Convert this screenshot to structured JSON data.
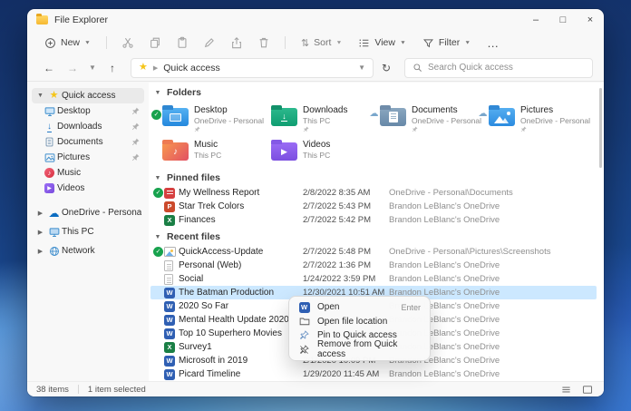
{
  "window": {
    "title": "File Explorer"
  },
  "icons": {
    "chevron_down": "▼",
    "chevron_right": "▶",
    "dropdown": "▼",
    "back": "←",
    "forward": "→",
    "up": "↑",
    "refresh": "↻",
    "more": "…",
    "minimize": "–",
    "maximize": "□",
    "close": "×",
    "star": "★",
    "cloud": "☁",
    "check": "✓",
    "arrow_down": "↓",
    "play": "▶",
    "note": "♪",
    "sort": "⇅",
    "word_letter": "W",
    "excel_letter": "X",
    "ppt_letter": "P"
  },
  "toolbar": {
    "new": "New",
    "sort": "Sort",
    "view": "View",
    "filter": "Filter"
  },
  "address": {
    "path": "Quick access",
    "search_placeholder": "Search Quick access"
  },
  "sidebar": {
    "items": [
      {
        "label": "Quick access"
      },
      {
        "label": "Desktop"
      },
      {
        "label": "Downloads"
      },
      {
        "label": "Documents"
      },
      {
        "label": "Pictures"
      },
      {
        "label": "Music"
      },
      {
        "label": "Videos"
      },
      {
        "label": "OneDrive - Personal"
      },
      {
        "label": "This PC"
      },
      {
        "label": "Network"
      }
    ]
  },
  "folders": {
    "title": "Folders",
    "tiles": [
      {
        "name": "Desktop",
        "location": "OneDrive - Personal"
      },
      {
        "name": "Downloads",
        "location": "This PC"
      },
      {
        "name": "Documents",
        "location": "OneDrive - Personal"
      },
      {
        "name": "Pictures",
        "location": "OneDrive - Personal"
      },
      {
        "name": "Music",
        "location": "This PC"
      },
      {
        "name": "Videos",
        "location": "This PC"
      }
    ]
  },
  "pinned": {
    "title": "Pinned files",
    "rows": [
      {
        "name": "My Wellness Report",
        "date": "2/8/2022 8:35 AM",
        "location": "OneDrive - Personal\\Documents"
      },
      {
        "name": "Star Trek Colors",
        "date": "2/7/2022 5:43 PM",
        "location": "Brandon LeBlanc's OneDrive"
      },
      {
        "name": "Finances",
        "date": "2/7/2022 5:42 PM",
        "location": "Brandon LeBlanc's OneDrive"
      }
    ]
  },
  "recent": {
    "title": "Recent files",
    "rows": [
      {
        "name": "QuickAccess-Update",
        "date": "2/7/2022 5:48 PM",
        "location": "OneDrive - Personal\\Pictures\\Screenshots"
      },
      {
        "name": "Personal (Web)",
        "date": "2/7/2022 1:36 PM",
        "location": "Brandon LeBlanc's OneDrive"
      },
      {
        "name": "Social",
        "date": "1/24/2022 3:59 PM",
        "location": "Brandon LeBlanc's OneDrive"
      },
      {
        "name": "The Batman Production",
        "date": "12/30/2021 10:51 AM",
        "location": "Brandon LeBlanc's OneDrive"
      },
      {
        "name": "2020 So Far",
        "date": "",
        "location": "Brandon LeBlanc's OneDrive"
      },
      {
        "name": "Mental Health Update 2020",
        "date": "",
        "location": "Brandon LeBlanc's OneDrive"
      },
      {
        "name": "Top 10 Superhero Movies",
        "date": "",
        "location": "Brandon LeBlanc's OneDrive"
      },
      {
        "name": "Survey1",
        "date": "",
        "location": "Brandon LeBlanc's OneDrive"
      },
      {
        "name": "Microsoft in 2019",
        "date": "2/1/2020 10:09 PM",
        "location": "Brandon LeBlanc's OneDrive"
      },
      {
        "name": "Picard Timeline",
        "date": "1/29/2020 11:45 AM",
        "location": "Brandon LeBlanc's OneDrive"
      }
    ]
  },
  "context_menu": {
    "items": [
      {
        "label": "Open",
        "shortcut": "Enter"
      },
      {
        "label": "Open file location"
      },
      {
        "label": "Pin to Quick access"
      },
      {
        "label": "Remove from Quick access"
      }
    ]
  },
  "statusbar": {
    "count": "38 items",
    "selected": "1 item selected"
  },
  "colors": {
    "accent": "#0067c0",
    "selection": "#cce8ff"
  }
}
